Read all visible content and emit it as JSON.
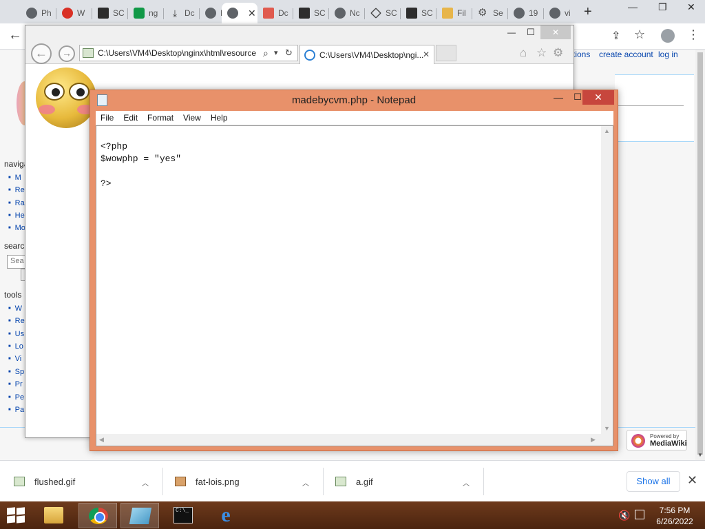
{
  "chrome": {
    "tabs": [
      {
        "label": "Ph",
        "icon": "globe-icon"
      },
      {
        "label": "W",
        "icon": "red-dot-icon"
      },
      {
        "label": "SC",
        "icon": "sql-icon"
      },
      {
        "label": "ng",
        "icon": "nginx-icon"
      },
      {
        "label": "Dc",
        "icon": "download-icon"
      },
      {
        "label": "M",
        "icon": "globe-icon"
      },
      {
        "label": "",
        "icon": "globe-icon",
        "active": true
      },
      {
        "label": "Dc",
        "icon": "pdf-icon"
      },
      {
        "label": "SC",
        "icon": "sql-icon"
      },
      {
        "label": "Nc",
        "icon": "globe-icon"
      },
      {
        "label": "SC",
        "icon": "diamond-icon"
      },
      {
        "label": "SC",
        "icon": "sql-icon"
      },
      {
        "label": "Fil",
        "icon": "folder-icon"
      },
      {
        "label": "Se",
        "icon": "gear-icon"
      },
      {
        "label": "19",
        "icon": "globe-icon"
      },
      {
        "label": "vi",
        "icon": "globe-icon"
      }
    ],
    "new_tab": "+",
    "win_min": "—",
    "win_max": "❐",
    "win_close": "✕",
    "back": "←",
    "share": "⇪",
    "star": "☆",
    "menu": "⋮"
  },
  "wiki": {
    "top_links": [
      "tions",
      "create account",
      "log in"
    ],
    "nav_heading": "naviga",
    "nav_items": [
      "M",
      "Re",
      "Ra",
      "He",
      "Mo"
    ],
    "search_heading": "search",
    "search_placeholder": "Sea",
    "tools_heading": "tools",
    "tools_items": [
      "W",
      "Re",
      "Us",
      "Lo",
      "Vi",
      "Sp",
      "Pr",
      "Pe",
      "Pa"
    ],
    "powered_line1": "Powered by",
    "powered_line2": "MediaWiki"
  },
  "ie": {
    "back": "←",
    "forward": "→",
    "address": "C:\\Users\\VM4\\Desktop\\nginx\\html\\resource",
    "address_icons": [
      "⌕",
      "▾",
      "↻"
    ],
    "tab_title": "C:\\Users\\VM4\\Desktop\\ngi...",
    "tab_close": "✕",
    "win_min": "—",
    "win_max": "☐",
    "win_close": "✕",
    "home": "⌂",
    "favorites": "☆",
    "settings": "⚙"
  },
  "notepad": {
    "title": "madebycvm.php - Notepad",
    "min": "—",
    "max": "☐",
    "close": "✕",
    "menu": [
      "File",
      "Edit",
      "Format",
      "View",
      "Help"
    ],
    "content": "<?php\n$wowphp = \"yes\"\n\n?>"
  },
  "downloads": {
    "items": [
      {
        "name": "flushed.gif",
        "type": "gif"
      },
      {
        "name": "fat-lois.png",
        "type": "png"
      },
      {
        "name": "a.gif",
        "type": "gif"
      }
    ],
    "show_all": "Show all",
    "close": "✕"
  },
  "taskbar": {
    "time": "7:56 PM",
    "date": "6/26/2022",
    "cmd_label": "C:\\_"
  }
}
